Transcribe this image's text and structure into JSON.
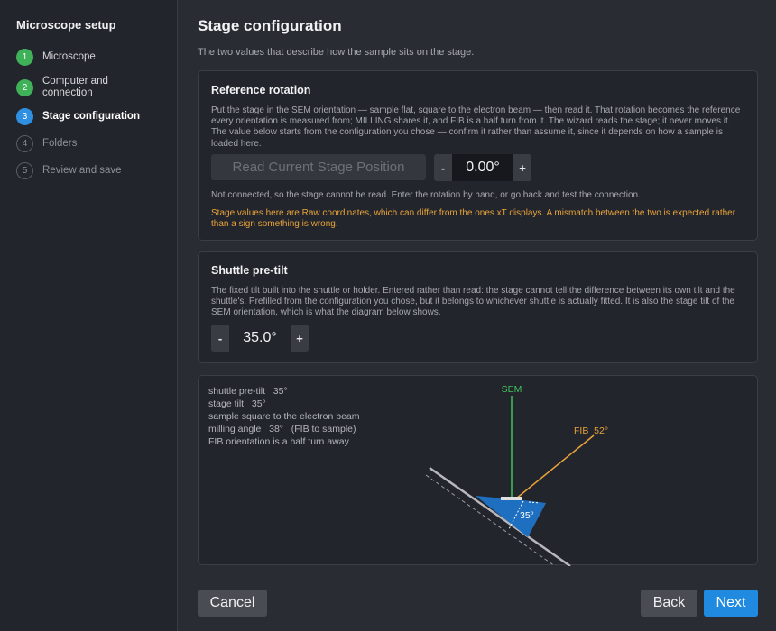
{
  "sidebar": {
    "title": "Microscope setup",
    "steps": [
      {
        "num": "1",
        "label": "Microscope",
        "state": "done"
      },
      {
        "num": "2",
        "label": "Computer and connection",
        "state": "done"
      },
      {
        "num": "3",
        "label": "Stage configuration",
        "state": "active"
      },
      {
        "num": "4",
        "label": "Folders",
        "state": "todo"
      },
      {
        "num": "5",
        "label": "Review and save",
        "state": "todo"
      }
    ]
  },
  "main": {
    "title": "Stage configuration",
    "subtitle": "The two values that describe how the sample sits on the stage."
  },
  "rotation": {
    "title": "Reference rotation",
    "description": "Put the stage in the SEM orientation — sample flat, square to the electron beam — then read it. That rotation becomes the reference every orientation is measured from; MILLING shares it, and FIB is a half turn from it. The wizard reads the stage; it never moves it. The value below starts from the configuration you chose — confirm it rather than assume it, since it depends on how a sample is loaded here.",
    "read_button": "Read Current Stage Position",
    "value": "0.00°",
    "minus": "-",
    "plus": "+",
    "not_connected": "Not connected, so the stage cannot be read. Enter the rotation by hand, or go back and test the connection.",
    "warning": "Stage values here are Raw coordinates, which can differ from the ones xT displays. A mismatch between the two is expected rather than a sign something is wrong."
  },
  "pretilt": {
    "title": "Shuttle pre-tilt",
    "description": "The fixed tilt built into the shuttle or holder. Entered rather than read: the stage cannot tell the difference between its own tilt and the shuttle's. Prefilled from the configuration you chose, but it belongs to whichever shuttle is actually fitted. It is also the stage tilt of the SEM orientation, which is what the diagram below shows.",
    "value": "35.0°",
    "minus": "-",
    "plus": "+"
  },
  "diagram": {
    "lines": [
      "shuttle pre-tilt   35°",
      "stage tilt   35°",
      "sample square to the electron beam",
      "milling angle   38°   (FIB to sample)",
      "FIB orientation is a half turn away"
    ],
    "sem_label": "SEM",
    "fib_label": "FIB  52°",
    "tilt_label": "35°",
    "colors": {
      "sem": "#3fc25a",
      "fib": "#e8a33a",
      "shuttle": "#1f6fc0"
    }
  },
  "footer": {
    "cancel": "Cancel",
    "back": "Back",
    "next": "Next"
  }
}
